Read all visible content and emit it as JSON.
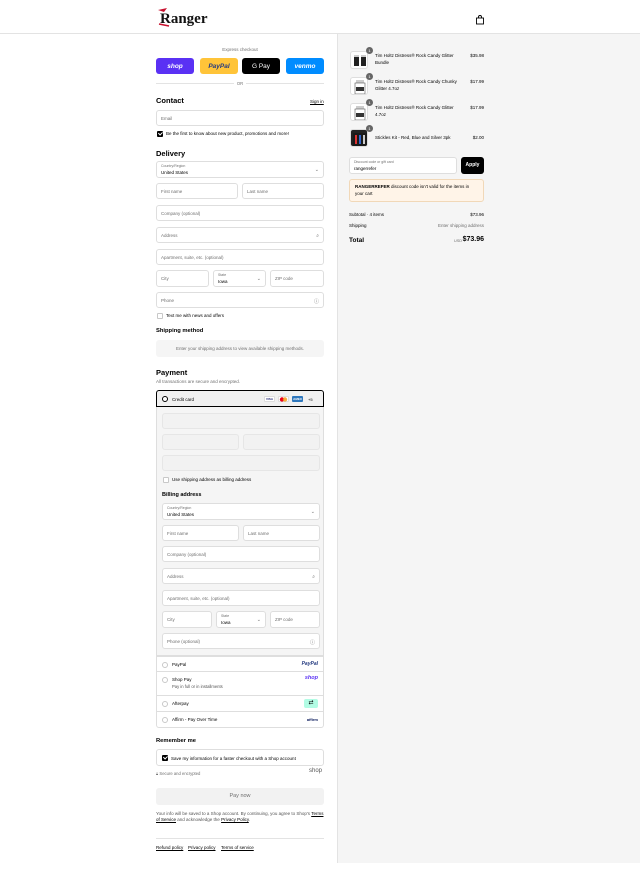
{
  "brand": {
    "logo_text": "Ranger"
  },
  "header": {
    "cart_icon": "shopping-bag-icon"
  },
  "express": {
    "title": "Express checkout",
    "buttons": [
      {
        "label": "shop",
        "color": "#5a31f4"
      },
      {
        "label": "PayPal",
        "color": "#ffc439"
      },
      {
        "label": "G Pay",
        "color": "#000000"
      },
      {
        "label": "venmo",
        "color": "#008cff"
      }
    ],
    "or": "OR"
  },
  "contact": {
    "title": "Contact",
    "sign_in": "Sign in",
    "email_placeholder": "Email",
    "news_label": "Be the first to know about new product, promotions and more!"
  },
  "delivery": {
    "title": "Delivery",
    "country_label": "Country/Region",
    "country_value": "United States",
    "first_name": "First name",
    "last_name": "Last name",
    "company": "Company (optional)",
    "address": "Address",
    "apartment": "Apartment, suite, etc. (optional)",
    "city": "City",
    "state_label": "State",
    "state_value": "Iowa",
    "zip": "ZIP code",
    "phone": "Phone",
    "text_me": "Text me with news and offers"
  },
  "shipping_method": {
    "title": "Shipping method",
    "message": "Enter your shipping address to view available shipping methods."
  },
  "payment": {
    "title": "Payment",
    "subtitle": "All transactions are secure and encrypted.",
    "credit_card": "Credit card",
    "cards": [
      "VISA",
      "MC",
      "AMEX"
    ],
    "more_cards": "+5",
    "use_shipping": "Use shipping address as billing address",
    "billing_title": "Billing address",
    "billing_phone": "Phone (optional)",
    "options": [
      {
        "label": "PayPal",
        "logo": "PayPal",
        "sub": ""
      },
      {
        "label": "Shop Pay",
        "logo": "shop",
        "sub": "Pay in full or in installments"
      },
      {
        "label": "Afterpay",
        "logo": "afterpay-icon",
        "sub": ""
      },
      {
        "label": "Affirm - Pay Over Time",
        "logo": "affirm",
        "sub": ""
      }
    ]
  },
  "remember": {
    "title": "Remember me",
    "save_label": "Save my information for a faster checkout with a Shop account",
    "secure": "Secure and encrypted",
    "shop_logo": "shop"
  },
  "pay_now": "Pay now",
  "legal": {
    "text1": "Your info will be saved to a Shop account. By continuing, you agree to Shop's",
    "tos": "Terms of Service",
    "and": "and acknowledge the",
    "privacy": "Privacy Policy",
    "end": "."
  },
  "footer_links": [
    "Refund policy",
    "Privacy policy",
    "Terms of service"
  ],
  "order": {
    "items": [
      {
        "qty": "1",
        "name": "Tim Holtz Distress® Rock Candy Glitter Bundle",
        "price": "$35.98"
      },
      {
        "qty": "1",
        "name": "Tim Holtz Distress® Rock Candy Chunky Glitter 4.7oz",
        "price": "$17.99"
      },
      {
        "qty": "1",
        "name": "Tim Holtz Distress® Rock Candy Glitter 4.7oz",
        "price": "$17.99"
      },
      {
        "qty": "1",
        "name": "Stickles Kit - Red, Blue and Silver 3pk",
        "price": "$2.00"
      }
    ],
    "discount_label": "Discount code or gift card",
    "discount_value": "rangerrefer",
    "apply": "Apply",
    "error_code": "RANGERREFER",
    "error_text": "discount code isn't valid for the items in your cart",
    "subtotal_label": "Subtotal · 4 items",
    "subtotal_value": "$73.96",
    "shipping_label": "Shipping",
    "shipping_value": "Enter shipping address",
    "total_label": "Total",
    "currency": "USD",
    "total_value": "$73.96"
  }
}
